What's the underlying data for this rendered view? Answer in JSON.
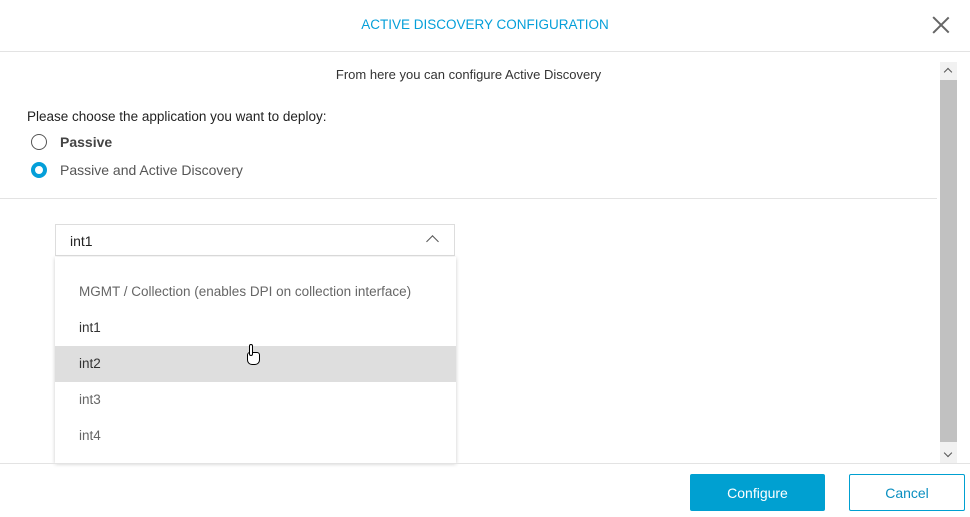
{
  "dialog": {
    "title": "ACTIVE DISCOVERY CONFIGURATION",
    "subtitle": "From here you can configure Active Discovery"
  },
  "form": {
    "prompt": "Please choose the application you want to deploy:",
    "options": [
      {
        "label": "Passive",
        "selected": false
      },
      {
        "label": "Passive and Active Discovery",
        "selected": true
      }
    ]
  },
  "interface_select": {
    "value": "int1",
    "options": [
      "MGMT / Collection (enables DPI on collection interface)",
      "int1",
      "int2",
      "int3",
      "int4"
    ],
    "hovered": "int2"
  },
  "buttons": {
    "configure": "Configure",
    "cancel": "Cancel"
  },
  "colors": {
    "accent": "#049fd9"
  }
}
